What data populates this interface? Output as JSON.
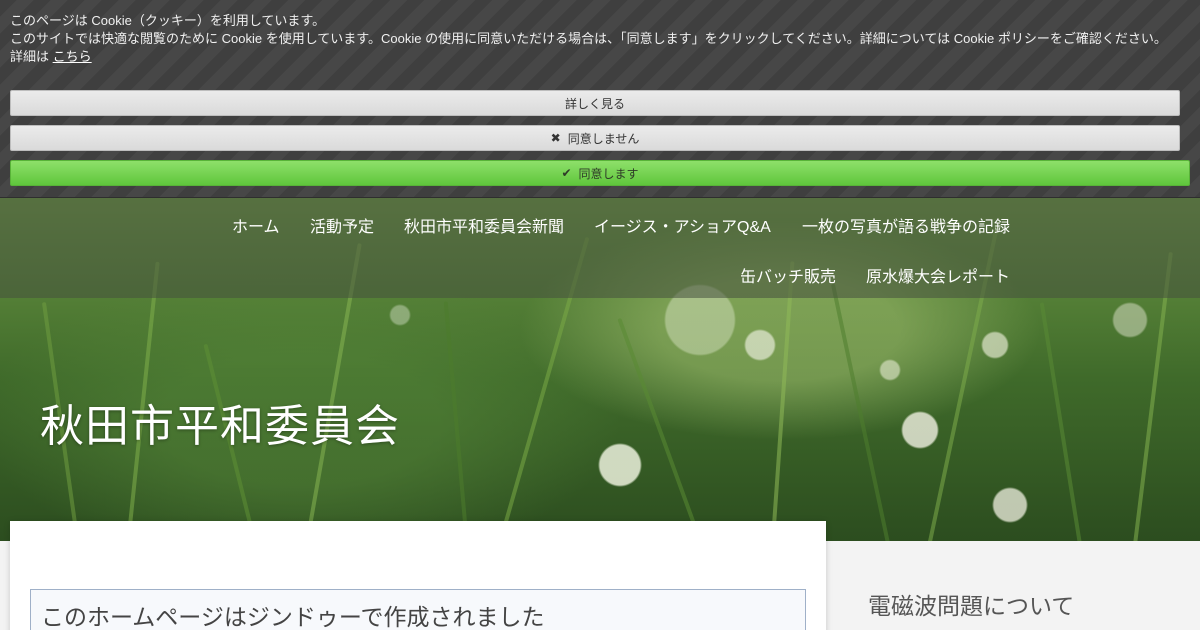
{
  "cookie_banner": {
    "line1": "このページは Cookie（クッキー）を利用しています。",
    "line2": "このサイトでは快適な閲覧のために Cookie を使用しています。Cookie の使用に同意いただける場合は、「同意します」をクリックしてください。詳細については Cookie ポリシーをご確認ください。",
    "details_prefix": "詳細は ",
    "details_link": "こちら",
    "learn_more_label": "詳しく見る",
    "decline_label": "同意しません",
    "accept_label": "同意します",
    "decline_icon": "close-icon",
    "accept_icon": "check-icon",
    "accept_color": "#6fd04a"
  },
  "navigation": {
    "items": [
      {
        "label": "ホーム"
      },
      {
        "label": "活動予定"
      },
      {
        "label": "秋田市平和委員会新聞"
      },
      {
        "label": "イージス・アショアQ&A"
      },
      {
        "label": "一枚の写真が語る戦争の記録"
      },
      {
        "label": "缶バッチ販売"
      },
      {
        "label": "原水爆大会レポート"
      }
    ]
  },
  "site": {
    "title": "秋田市平和委員会"
  },
  "main": {
    "notice": "このホームページはジンドゥーで作成されました"
  },
  "sidebar": {
    "heading": "電磁波問題について"
  }
}
